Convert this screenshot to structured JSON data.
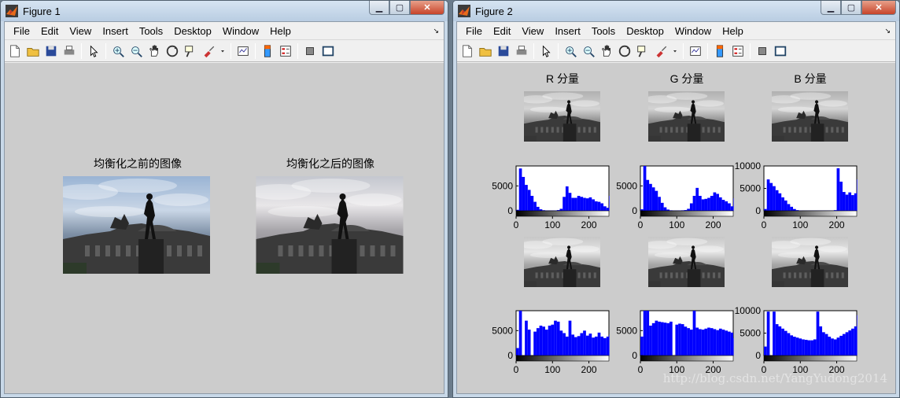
{
  "colors": {
    "hist_blue": "#0000ff",
    "canvas": "#cccccc"
  },
  "fig1": {
    "title": "Figure 1",
    "menu": [
      "File",
      "Edit",
      "View",
      "Insert",
      "Tools",
      "Desktop",
      "Window",
      "Help"
    ],
    "axes": [
      {
        "title": "均衡化之前的图像"
      },
      {
        "title": "均衡化之后的图像"
      }
    ]
  },
  "fig2": {
    "title": "Figure 2",
    "menu": [
      "File",
      "Edit",
      "View",
      "Insert",
      "Tools",
      "Desktop",
      "Window",
      "Help"
    ],
    "channel_titles": [
      "R 分量",
      "G 分量",
      "B 分量"
    ],
    "watermark": "http://blog.csdn.net/YangYudong2014"
  },
  "toolbar_icons": [
    "new-figure-icon",
    "open-file-icon",
    "save-icon",
    "print-icon",
    "edit-plot-icon",
    "zoom-in-icon",
    "zoom-out-icon",
    "pan-icon",
    "rotate-3d-icon",
    "data-cursor-icon",
    "brush-icon",
    "brush-dropdown-icon",
    "link-plot-icon",
    "colorbar-icon",
    "legend-icon",
    "hide-plot-tools-icon",
    "show-plot-tools-icon"
  ],
  "chart_data": [
    {
      "type": "bar",
      "panel": "R-before",
      "x": [
        0,
        8,
        16,
        24,
        32,
        40,
        48,
        56,
        64,
        72,
        80,
        88,
        96,
        104,
        112,
        120,
        128,
        136,
        144,
        152,
        160,
        168,
        176,
        184,
        192,
        200,
        208,
        216,
        224,
        232,
        240,
        248,
        255
      ],
      "values": [
        200,
        8500,
        6800,
        5200,
        4200,
        3000,
        1800,
        800,
        300,
        120,
        80,
        60,
        60,
        80,
        150,
        400,
        2800,
        4900,
        3600,
        2600,
        2600,
        3000,
        2800,
        2600,
        2500,
        2700,
        2300,
        1900,
        1800,
        1500,
        900,
        600,
        3000
      ],
      "xlim": [
        0,
        255
      ],
      "ylim": [
        0,
        9000
      ],
      "xticks": [
        0,
        100,
        200
      ],
      "yticks": [
        0,
        5000
      ]
    },
    {
      "type": "bar",
      "panel": "G-before",
      "x": [
        0,
        8,
        16,
        24,
        32,
        40,
        48,
        56,
        64,
        72,
        80,
        88,
        96,
        104,
        112,
        120,
        128,
        136,
        144,
        152,
        160,
        168,
        176,
        184,
        192,
        200,
        208,
        216,
        224,
        232,
        240,
        248,
        255
      ],
      "values": [
        300,
        9000,
        6200,
        5400,
        4700,
        4000,
        2800,
        1600,
        700,
        250,
        100,
        60,
        60,
        80,
        100,
        150,
        400,
        1500,
        3000,
        4600,
        3000,
        2300,
        2400,
        2600,
        3000,
        3700,
        3400,
        2700,
        2200,
        1900,
        1500,
        900,
        2500
      ],
      "xlim": [
        0,
        255
      ],
      "ylim": [
        0,
        9000
      ],
      "xticks": [
        0,
        100,
        200
      ],
      "yticks": [
        0,
        5000
      ]
    },
    {
      "type": "bar",
      "panel": "B-before",
      "x": [
        0,
        8,
        16,
        24,
        32,
        40,
        48,
        56,
        64,
        72,
        80,
        88,
        96,
        104,
        112,
        120,
        128,
        136,
        144,
        152,
        160,
        168,
        176,
        184,
        192,
        200,
        208,
        216,
        224,
        232,
        240,
        248,
        255
      ],
      "values": [
        400,
        7000,
        6200,
        5500,
        4600,
        3900,
        3000,
        2300,
        1500,
        900,
        400,
        150,
        60,
        40,
        40,
        40,
        40,
        40,
        40,
        40,
        40,
        40,
        40,
        40,
        150,
        9500,
        6500,
        4200,
        3600,
        4100,
        3500,
        3900,
        7000
      ],
      "xlim": [
        0,
        255
      ],
      "ylim": [
        0,
        10000
      ],
      "xticks": [
        0,
        100,
        200
      ],
      "yticks": [
        0,
        5000,
        10000
      ]
    },
    {
      "type": "bar",
      "panel": "R-after",
      "x": [
        0,
        8,
        16,
        24,
        32,
        40,
        48,
        56,
        64,
        72,
        80,
        88,
        96,
        104,
        112,
        120,
        128,
        136,
        144,
        152,
        160,
        168,
        176,
        184,
        192,
        200,
        208,
        216,
        224,
        232,
        240,
        248,
        255
      ],
      "values": [
        1500,
        9000,
        0,
        7000,
        5200,
        0,
        4800,
        5500,
        6000,
        5800,
        5200,
        6000,
        6200,
        7000,
        6800,
        5000,
        4500,
        3800,
        7000,
        4200,
        3700,
        3900,
        4500,
        5000,
        4000,
        4400,
        3600,
        3800,
        4600,
        3800,
        3500,
        3800,
        4200
      ],
      "xlim": [
        0,
        255
      ],
      "ylim": [
        0,
        9000
      ],
      "xticks": [
        0,
        100,
        200
      ],
      "yticks": [
        0,
        5000
      ]
    },
    {
      "type": "bar",
      "panel": "G-after",
      "x": [
        0,
        8,
        16,
        24,
        32,
        40,
        48,
        56,
        64,
        72,
        80,
        88,
        96,
        104,
        112,
        120,
        128,
        136,
        144,
        152,
        160,
        168,
        176,
        184,
        192,
        200,
        208,
        216,
        224,
        232,
        240,
        248,
        255
      ],
      "values": [
        3800,
        9000,
        9000,
        6000,
        6500,
        7000,
        6800,
        6700,
        6600,
        6500,
        6800,
        0,
        6200,
        6400,
        6300,
        5800,
        5500,
        5200,
        9000,
        5600,
        5300,
        5200,
        5400,
        5600,
        5500,
        5300,
        5100,
        5400,
        5200,
        5000,
        4800,
        4600,
        3500
      ],
      "xlim": [
        0,
        255
      ],
      "ylim": [
        0,
        9000
      ],
      "xticks": [
        0,
        100,
        200
      ],
      "yticks": [
        0,
        5000
      ]
    },
    {
      "type": "bar",
      "panel": "B-after",
      "x": [
        0,
        8,
        16,
        24,
        32,
        40,
        48,
        56,
        64,
        72,
        80,
        88,
        96,
        104,
        112,
        120,
        128,
        136,
        144,
        152,
        160,
        168,
        176,
        184,
        192,
        200,
        208,
        216,
        224,
        232,
        240,
        248,
        255
      ],
      "values": [
        2000,
        9800,
        0,
        9800,
        7000,
        6500,
        6000,
        5500,
        5000,
        4500,
        4200,
        4000,
        3800,
        3600,
        3500,
        3400,
        3400,
        3600,
        9800,
        6500,
        5200,
        4800,
        4200,
        3800,
        3600,
        4000,
        4400,
        4800,
        5200,
        5600,
        6000,
        6500,
        9000
      ],
      "xlim": [
        0,
        255
      ],
      "ylim": [
        0,
        10000
      ],
      "xticks": [
        0,
        100,
        200
      ],
      "yticks": [
        0,
        5000,
        10000
      ]
    }
  ]
}
